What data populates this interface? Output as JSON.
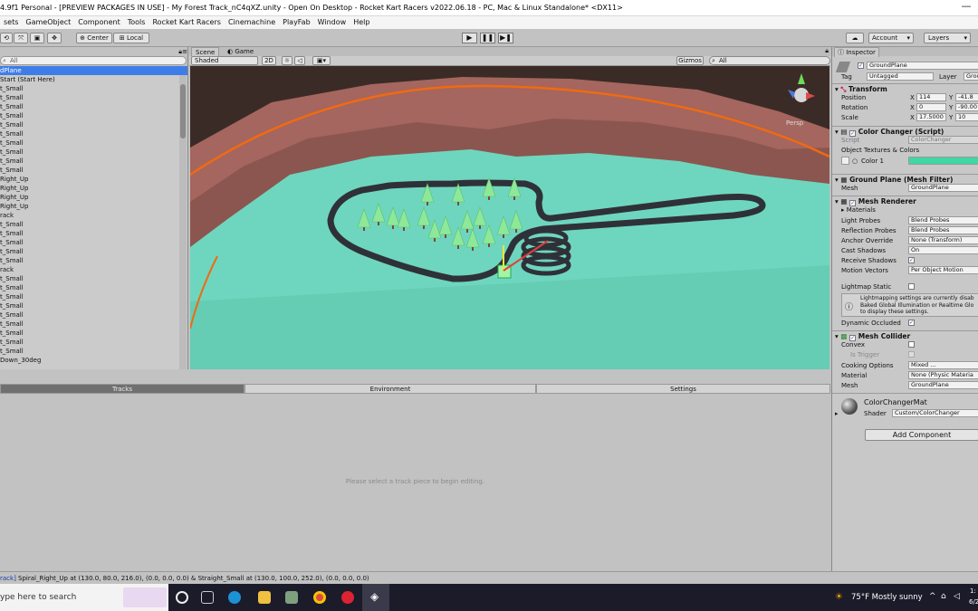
{
  "window": {
    "title": "4.9f1 Personal - [PREVIEW PACKAGES IN USE] - My Forest Track_nC4qXZ.unity - Open On Desktop - Rocket Kart Racers v2022.06.18 - PC, Mac & Linux Standalone* <DX11>",
    "minimize": "—"
  },
  "menu": [
    "sets",
    "GameObject",
    "Component",
    "Tools",
    "Rocket Kart Racers",
    "Cinemachine",
    "PlayFab",
    "Window",
    "Help"
  ],
  "toolbar": {
    "pivot": "Center",
    "space": "Local",
    "account": "Account",
    "layers": "Layers",
    "play": "▶",
    "pause": "❚❚",
    "step": "▶❚"
  },
  "hierarchy": {
    "search_placeholder": "All",
    "items": [
      {
        "label": "dPlane",
        "selected": true
      },
      {
        "label": "Start (Start Here)"
      },
      {
        "label": "t_Small"
      },
      {
        "label": "t_Small"
      },
      {
        "label": "t_Small"
      },
      {
        "label": "t_Small"
      },
      {
        "label": "t_Small"
      },
      {
        "label": "t_Small"
      },
      {
        "label": "t_Small"
      },
      {
        "label": "t_Small"
      },
      {
        "label": "t_Small"
      },
      {
        "label": "t_Small"
      },
      {
        "label": "Right_Up"
      },
      {
        "label": "Right_Up"
      },
      {
        "label": "Right_Up"
      },
      {
        "label": "Right_Up"
      },
      {
        "label": "rack"
      },
      {
        "label": "t_Small"
      },
      {
        "label": "t_Small"
      },
      {
        "label": "t_Small"
      },
      {
        "label": "t_Small"
      },
      {
        "label": "t_Small"
      },
      {
        "label": "rack"
      },
      {
        "label": "t_Small"
      },
      {
        "label": "t_Small"
      },
      {
        "label": "t_Small"
      },
      {
        "label": "t_Small"
      },
      {
        "label": "t_Small"
      },
      {
        "label": "t_Small"
      },
      {
        "label": "t_Small"
      },
      {
        "label": "t_Small"
      },
      {
        "label": "t_Small"
      },
      {
        "label": "Down_30deg"
      }
    ]
  },
  "scene": {
    "tabs": [
      "Scene",
      "Game"
    ],
    "shading": "Shaded",
    "mode_2d": "2D",
    "gizmos": "Gizmos",
    "search_placeholder": "All",
    "persp": "Persp"
  },
  "lower": {
    "tabs": [
      "Tracks",
      "Environment",
      "Settings"
    ],
    "message": "Please select a track piece to begin editing."
  },
  "status": {
    "prefix": "rack]",
    "text": " Spiral_Right_Up at (130.0, 80.0, 216.0), (0.0, 0.0, 0.0) & Straight_Small at (130.0, 100.0, 252.0), (0.0, 0.0, 0.0)"
  },
  "inspector": {
    "tab": "Inspector",
    "object_name": "GroundPlane",
    "tag_label": "Tag",
    "tag": "Untagged",
    "layer_label": "Layer",
    "layer": "Grou",
    "transform": {
      "title": "Transform",
      "position_label": "Position",
      "pos_x": "114",
      "pos_y": "-41.8",
      "rotation_label": "Rotation",
      "rot_x": "0",
      "rot_y": "-90.00",
      "scale_label": "Scale",
      "scale_x": "17.5000",
      "scale_y": "10"
    },
    "color_changer": {
      "title": "Color Changer (Script)",
      "script_label": "Script",
      "script": "ColorChanger",
      "textures_label": "Object Textures & Colors",
      "color1_label": "Color 1",
      "color1": "#3fd7a6"
    },
    "mesh_filter": {
      "title": "Ground Plane (Mesh Filter)",
      "mesh_label": "Mesh",
      "mesh": "GroundPlane"
    },
    "mesh_renderer": {
      "title": "Mesh Renderer",
      "materials_label": "Materials",
      "light_probes_label": "Light Probes",
      "light_probes": "Blend Probes",
      "reflection_probes_label": "Reflection Probes",
      "reflection_probes": "Blend Probes",
      "anchor_label": "Anchor Override",
      "anchor": "None (Transform)",
      "cast_shadows_label": "Cast Shadows",
      "cast_shadows": "On",
      "receive_shadows_label": "Receive Shadows",
      "motion_vectors_label": "Motion Vectors",
      "motion_vectors": "Per Object Motion",
      "lightmap_static_label": "Lightmap Static",
      "info": [
        "Lightmapping settings are currently disab",
        "Baked Global Illumination or Realtime Glo",
        "to display these settings."
      ],
      "dynamic_occluded_label": "Dynamic Occluded"
    },
    "mesh_collider": {
      "title": "Mesh Collider",
      "convex_label": "Convex",
      "trigger_label": "Is Trigger",
      "cooking_label": "Cooking Options",
      "cooking": "Mixed ...",
      "material_label": "Material",
      "material": "None (Physic Materia",
      "mesh_label": "Mesh",
      "mesh": "GroundPlane"
    },
    "material": {
      "name": "ColorChangerMat",
      "shader_label": "Shader",
      "shader": "Custom/ColorChanger"
    },
    "add_component": "Add Component"
  },
  "taskbar": {
    "search_placeholder": "ype here to search",
    "weather": "75°F  Mostly sunny",
    "clock_time": "1:",
    "clock_date": "6/2"
  },
  "colors": {
    "ground": "#6ed6be",
    "mountains": "#a4665e",
    "boundary": "#f06a12",
    "track": "#2f3138",
    "tree": "#8de89a",
    "selection": "#3e7de7"
  }
}
